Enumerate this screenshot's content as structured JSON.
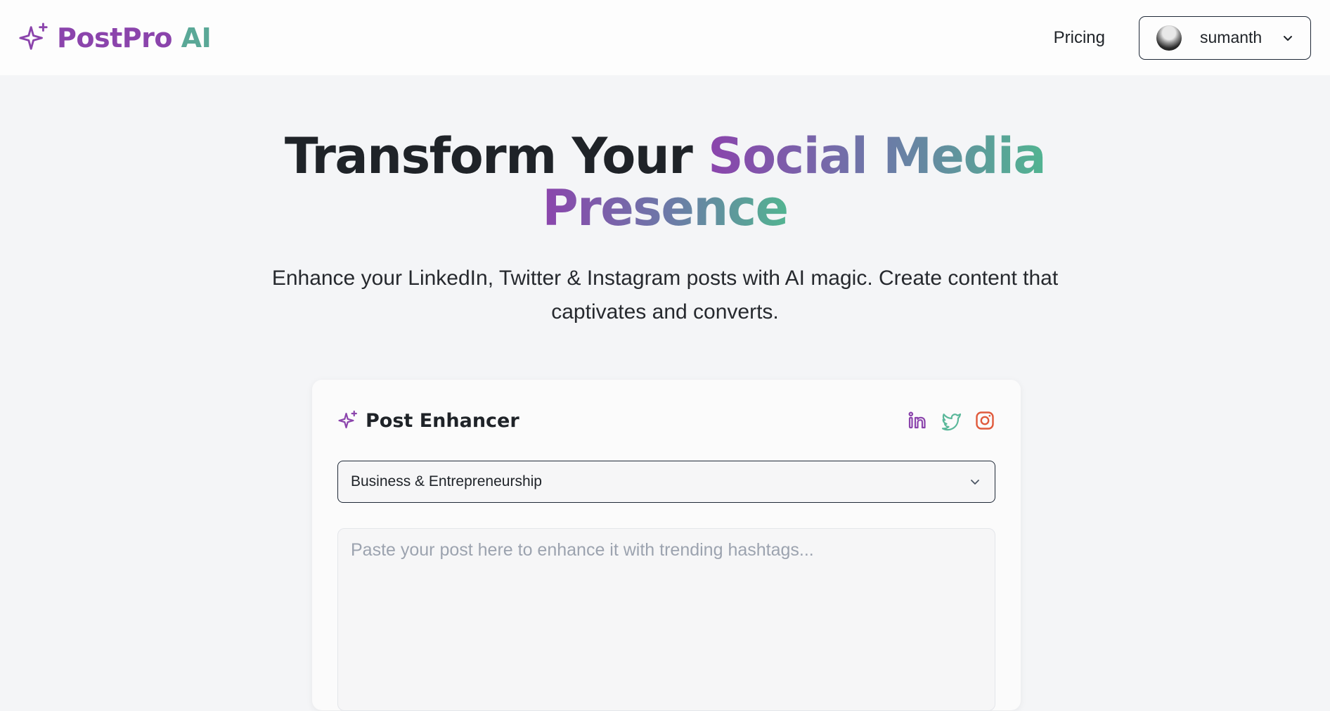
{
  "brand": {
    "name_part1": "PostPro",
    "name_part2": "AI",
    "icon": "sparkle-icon",
    "colors": {
      "purple": "#8b44ac",
      "teal": "#5aa897"
    }
  },
  "nav": {
    "pricing_label": "Pricing",
    "user": {
      "name": "sumanth",
      "avatar": "user-avatar",
      "menu_icon": "chevron-down-icon"
    }
  },
  "hero": {
    "title_plain": "Transform Your ",
    "title_highlight_line1": "Social Media",
    "title_highlight_line2": "Presence",
    "subtitle": "Enhance your LinkedIn, Twitter & Instagram posts with AI magic. Create content that captivates and converts."
  },
  "card": {
    "title": "Post Enhancer",
    "icon": "sparkle-icon",
    "platforms": [
      {
        "name": "linkedin",
        "icon": "linkedin-icon",
        "color": "#8b44ac"
      },
      {
        "name": "twitter",
        "icon": "twitter-icon",
        "color": "#5ab89a"
      },
      {
        "name": "instagram",
        "icon": "instagram-icon",
        "color": "#e05a3c"
      }
    ],
    "category_select": {
      "value": "Business & Entrepreneurship"
    },
    "post_input": {
      "value": "",
      "placeholder": "Paste your post here to enhance it with trending hashtags..."
    }
  }
}
